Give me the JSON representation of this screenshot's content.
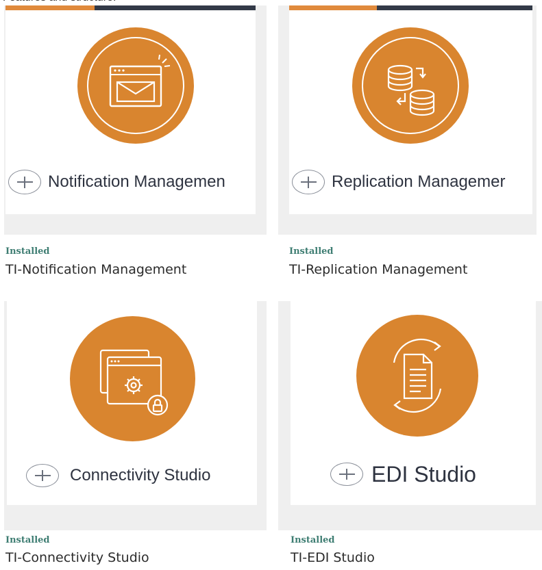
{
  "page": {
    "header_cut_text": "Features and structure."
  },
  "tiles": [
    {
      "product_label": "Notification Managemen",
      "status": "Installed",
      "name": "TI-Notification Management",
      "icon": "envelope-window-icon"
    },
    {
      "product_label": "Replication Managemer",
      "status": "Installed",
      "name": "TI-Replication Management",
      "icon": "database-sync-icon"
    },
    {
      "product_label": "Connectivity Studio",
      "status": "Installed",
      "name": "TI-Connectivity Studio",
      "icon": "windows-gear-lock-icon"
    },
    {
      "product_label": "EDI Studio",
      "status": "Installed",
      "name": "TI-EDI Studio",
      "icon": "document-cycle-icon"
    }
  ],
  "colors": {
    "icon_orange": "#d9852f",
    "accent_dark": "#333a48",
    "accent_orange": "#e08a3c",
    "status_green": "#3e7d72"
  }
}
